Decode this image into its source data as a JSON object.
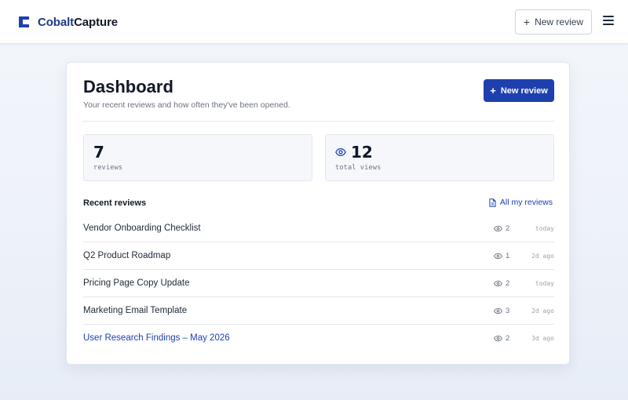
{
  "app": {
    "brand_part1": "Cobalt",
    "brand_part2": "Capture",
    "accent_color": "#1e40af"
  },
  "topbar": {
    "new_review_label": "New review",
    "menu_icon": "hamburger-menu-icon"
  },
  "dashboard": {
    "title": "Dashboard",
    "subtitle": "Your recent reviews and how often they've been opened.",
    "new_review_label": "New review"
  },
  "stats": [
    {
      "value": "7",
      "label": "reviews",
      "icon": null
    },
    {
      "value": "12",
      "label": "total views",
      "icon": "eye-icon"
    }
  ],
  "recent": {
    "heading": "Recent reviews",
    "all_link_label": "All my reviews",
    "items": [
      {
        "title": "Vendor Onboarding Checklist",
        "views": "2",
        "time": "today",
        "highlighted": false
      },
      {
        "title": "Q2 Product Roadmap",
        "views": "1",
        "time": "2d ago",
        "highlighted": false
      },
      {
        "title": "Pricing Page Copy Update",
        "views": "2",
        "time": "today",
        "highlighted": false
      },
      {
        "title": "Marketing Email Template",
        "views": "3",
        "time": "2d ago",
        "highlighted": false
      },
      {
        "title": "User Research Findings – May 2026",
        "views": "2",
        "time": "3d ago",
        "highlighted": true
      }
    ]
  }
}
